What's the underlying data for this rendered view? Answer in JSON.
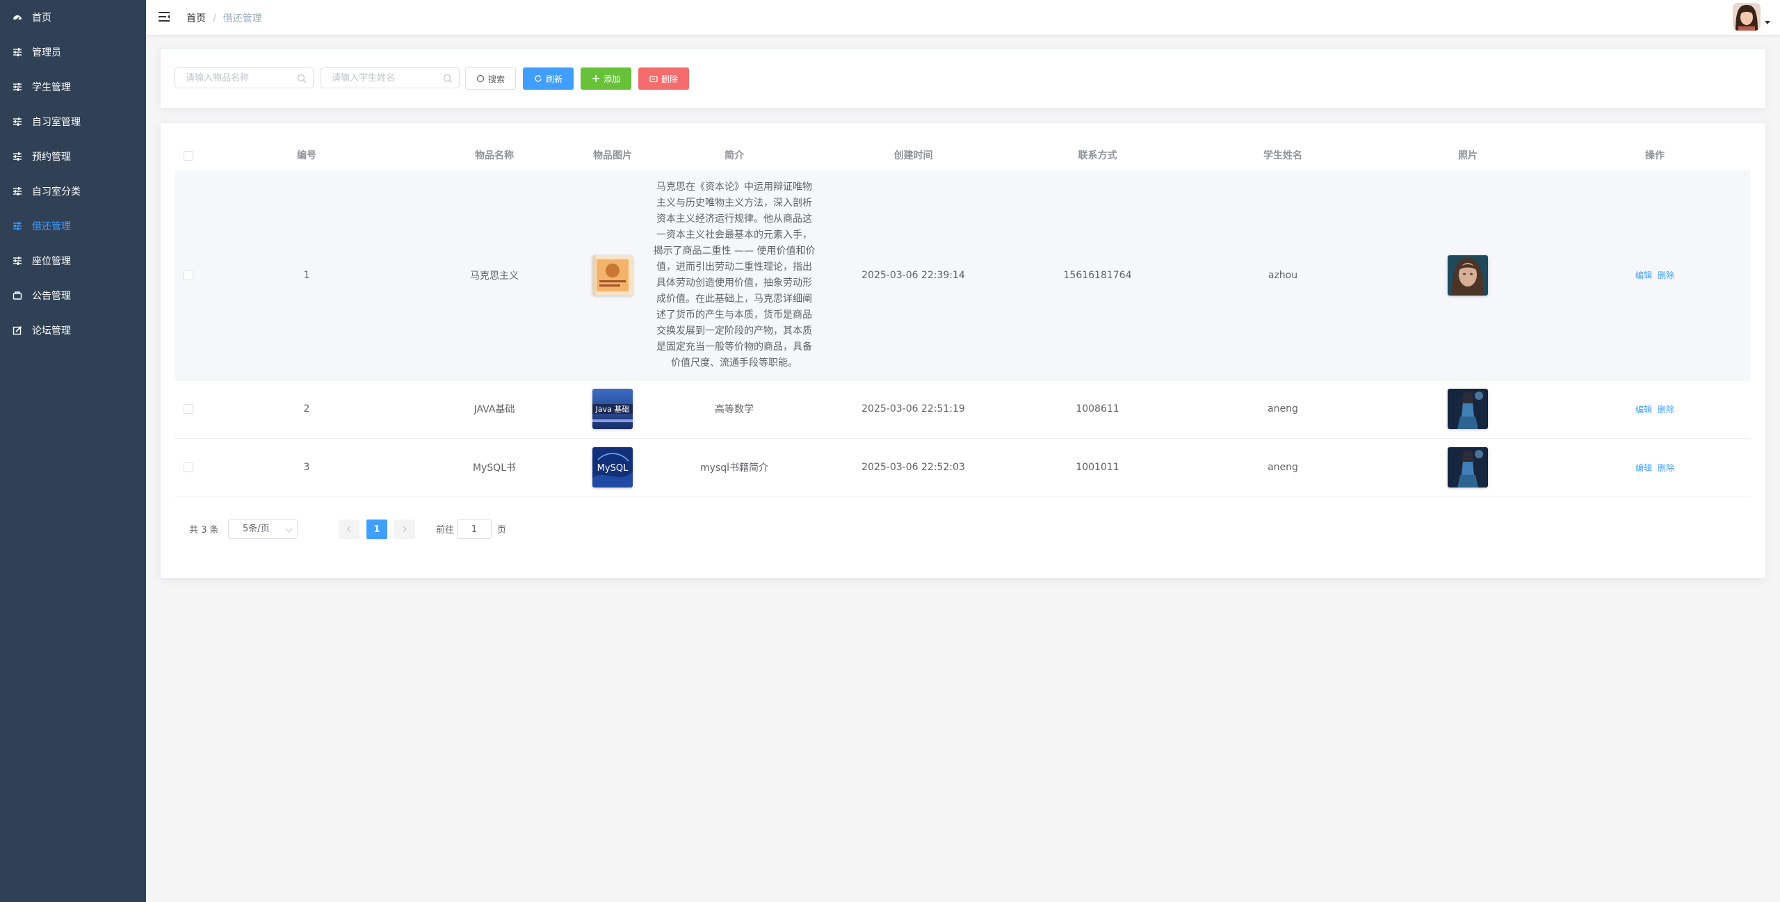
{
  "sidebar": {
    "items": [
      {
        "label": "首页",
        "icon": "dashboard-icon",
        "active": false
      },
      {
        "label": "管理员",
        "icon": "sliders-icon",
        "active": false
      },
      {
        "label": "学生管理",
        "icon": "sliders-icon",
        "active": false
      },
      {
        "label": "自习室管理",
        "icon": "sliders-icon",
        "active": false
      },
      {
        "label": "预约管理",
        "icon": "sliders-icon",
        "active": false
      },
      {
        "label": "自习室分类",
        "icon": "sliders-icon",
        "active": false
      },
      {
        "label": "借还管理",
        "icon": "sliders-icon",
        "active": true
      },
      {
        "label": "座位管理",
        "icon": "sliders-icon",
        "active": false
      },
      {
        "label": "公告管理",
        "icon": "notice-icon",
        "active": false
      },
      {
        "label": "论坛管理",
        "icon": "edit-icon",
        "active": false
      }
    ]
  },
  "header": {
    "breadcrumb_home": "首页",
    "breadcrumb_separator": "/",
    "breadcrumb_current": "借还管理"
  },
  "search": {
    "item_name_placeholder": "请输入物品名称",
    "student_name_placeholder": "请输入学生姓名",
    "search_label": "搜索",
    "refresh_label": "刷新",
    "add_label": "添加",
    "delete_label": "删除"
  },
  "table": {
    "columns": {
      "id": "编号",
      "item_name": "物品名称",
      "item_image": "物品图片",
      "description": "简介",
      "created": "创建时间",
      "contact": "联系方式",
      "student_name": "学生姓名",
      "photo": "照片",
      "actions": "操作"
    },
    "rows": [
      {
        "id": "1",
        "item_name": "马克思主义",
        "description": "马克思在《资本论》中运用辩证唯物主义与历史唯物主义方法，深入剖析资本主义经济运行规律。他从商品这一资本主义社会最基本的元素入手，揭示了商品二重性 —— 使用价值和价值，进而引出劳动二重性理论，指出具体劳动创造使用价值，抽象劳动形成价值。在此基础上，马克思详细阐述了货币的产生与本质，货币是商品交换发展到一定阶段的产物，其本质是固定充当一般等价物的商品，具备价值尺度、流通手段等职能。",
        "created": "2025-03-06 22:39:14",
        "contact": "15616181764",
        "student_name": "azhou",
        "edit_label": "编辑",
        "delete_label": "删除"
      },
      {
        "id": "2",
        "item_name": "JAVA基础",
        "item_image_text": "Java 基础",
        "description": "高等数学",
        "created": "2025-03-06 22:51:19",
        "contact": "1008611",
        "student_name": "aneng",
        "edit_label": "编辑",
        "delete_label": "删除"
      },
      {
        "id": "3",
        "item_name": "MySQL书",
        "item_image_text": "MySQL",
        "description": "mysql书籍简介",
        "created": "2025-03-06 22:52:03",
        "contact": "1001011",
        "student_name": "aneng",
        "edit_label": "编辑",
        "delete_label": "删除"
      }
    ]
  },
  "pagination": {
    "total_text": "共 3 条",
    "page_size": "5条/页",
    "current_page": "1",
    "goto_label": "前往",
    "goto_value": "1",
    "page_unit": "页",
    "prev_icon": "chevron-left-icon",
    "next_icon": "chevron-right-icon"
  },
  "colors": {
    "sidebar_bg": "#304156",
    "accent": "#409eff",
    "success": "#67c23a",
    "danger": "#f56c6c"
  }
}
